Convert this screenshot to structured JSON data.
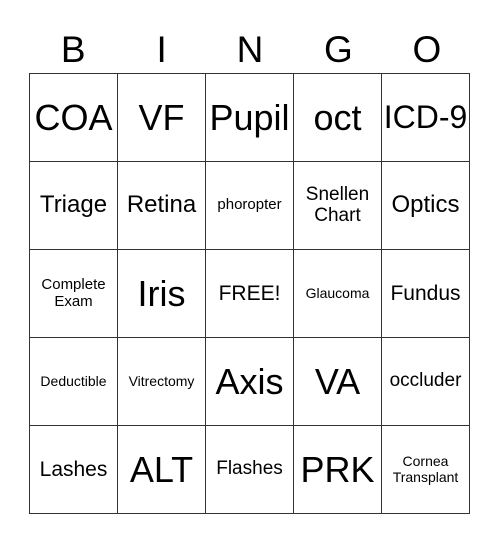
{
  "header": [
    "B",
    "I",
    "N",
    "G",
    "O"
  ],
  "cells": [
    {
      "text": "COA",
      "size": "s-xl"
    },
    {
      "text": "VF",
      "size": "s-xl"
    },
    {
      "text": "Pupil",
      "size": "s-xl"
    },
    {
      "text": "oct",
      "size": "s-xl"
    },
    {
      "text": "ICD-9",
      "size": "s-l"
    },
    {
      "text": "Triage",
      "size": "s-m"
    },
    {
      "text": "Retina",
      "size": "s-m"
    },
    {
      "text": "phoropter",
      "size": "s-xs"
    },
    {
      "text": "Snellen Chart",
      "size": "s-s"
    },
    {
      "text": "Optics",
      "size": "s-m"
    },
    {
      "text": "Complete Exam",
      "size": "s-xs"
    },
    {
      "text": "Iris",
      "size": "s-xl"
    },
    {
      "text": "FREE!",
      "size": "s-ms"
    },
    {
      "text": "Glaucoma",
      "size": "s-xxs"
    },
    {
      "text": "Fundus",
      "size": "s-ms"
    },
    {
      "text": "Deductible",
      "size": "s-xxs"
    },
    {
      "text": "Vitrectomy",
      "size": "s-xxs"
    },
    {
      "text": "Axis",
      "size": "s-xl"
    },
    {
      "text": "VA",
      "size": "s-xl"
    },
    {
      "text": "occluder",
      "size": "s-s"
    },
    {
      "text": "Lashes",
      "size": "s-ms"
    },
    {
      "text": "ALT",
      "size": "s-xl"
    },
    {
      "text": "Flashes",
      "size": "s-s"
    },
    {
      "text": "PRK",
      "size": "s-xl"
    },
    {
      "text": "Cornea Transplant",
      "size": "s-xxs"
    }
  ]
}
